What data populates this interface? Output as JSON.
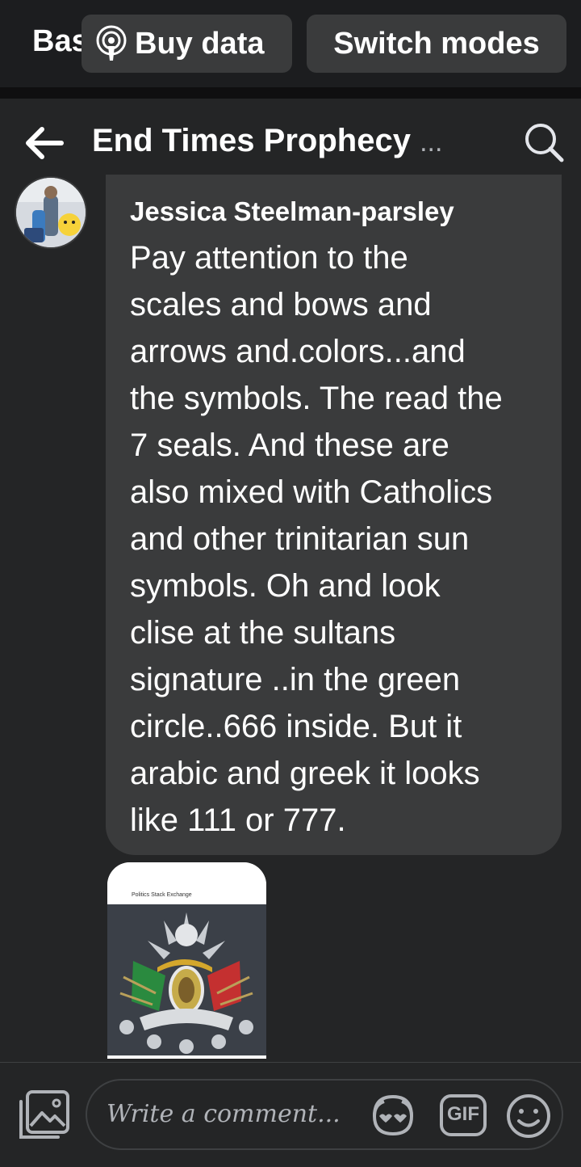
{
  "topbar": {
    "partial_label": "Bas",
    "buy_data_label": "Buy data",
    "switch_modes_label": "Switch modes"
  },
  "header": {
    "title": "End Times Prophecy",
    "title_ellipsis": "..."
  },
  "comment": {
    "author": "Jessica Steelman-parsley",
    "text": "Pay attention to the\nscales and bows and\narrows and.colors...and\nthe symbols. The read the\n7 seals. And these are\nalso mixed with Catholics\nand other trinitarian sun\nsymbols. Oh and look\nclise at the sultans\nsignature ..in the green\ncircle..666 inside. But it\narabic and greek it looks\nlike 111 or 777.",
    "attachment": {
      "site_label": "Politics Stack Exchange"
    }
  },
  "composer": {
    "placeholder": "Write a comment...",
    "gif_label": "GIF"
  },
  "icons": {
    "buy_data": "podcast-icon",
    "back": "arrow-left-icon",
    "search": "search-icon",
    "photo": "photo-icon",
    "sticker": "sticker-icon",
    "gif": "gif-icon",
    "emoji": "emoji-icon"
  },
  "colors": {
    "background": "#242526",
    "bubble": "#3a3b3c",
    "pill": "#3a3b3c",
    "text_primary": "#ffffff",
    "text_secondary": "#b0b3b8"
  }
}
